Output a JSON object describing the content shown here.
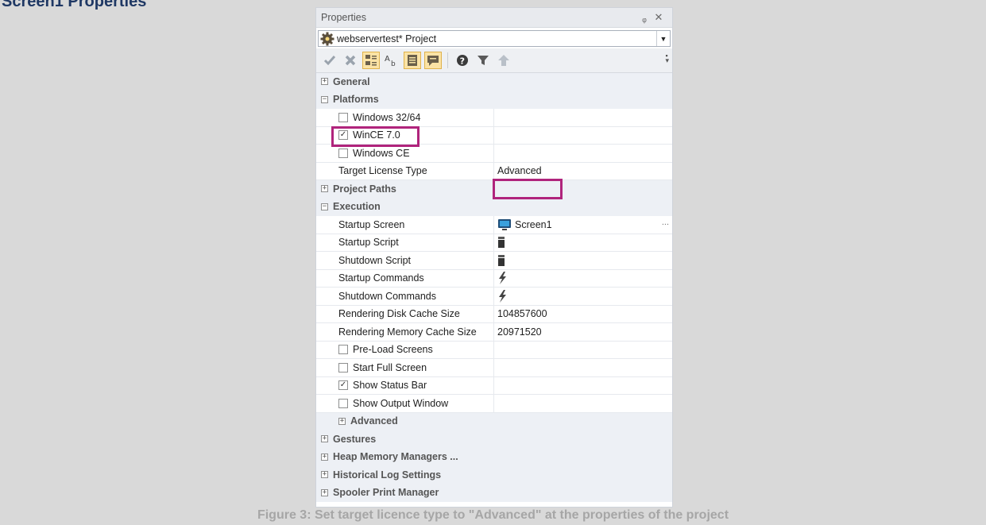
{
  "page": {
    "heading": "Screen1 Properties",
    "caption": "Figure 3: Set target licence type to \"Advanced\" at the properties of the project"
  },
  "panel": {
    "title": "Properties",
    "pin_icon": "pin-icon",
    "close_icon": "close-icon",
    "object_selector": {
      "value": "webservertest* Project"
    },
    "toolbar": {
      "buttons": [
        "apply-icon",
        "cancel-icon",
        "categorized-icon",
        "alphabetical-icon",
        "properties-icon",
        "events-icon",
        "help-icon",
        "filter-icon",
        "up-icon"
      ]
    }
  },
  "rows": {
    "general": "General",
    "platforms": "Platforms",
    "win3264": "Windows 32/64",
    "wince70": "WinCE 7.0",
    "wince": "Windows CE",
    "target_license_type": "Target License Type",
    "target_license_value": "Advanced",
    "project_paths": "Project Paths",
    "execution": "Execution",
    "startup_screen": "Startup Screen",
    "startup_screen_value": "Screen1",
    "startup_script": "Startup Script",
    "shutdown_script": "Shutdown Script",
    "startup_commands": "Startup Commands",
    "shutdown_commands": "Shutdown Commands",
    "disk_cache": "Rendering Disk Cache Size",
    "disk_cache_value": "104857600",
    "memory_cache": "Rendering Memory Cache Size",
    "memory_cache_value": "20971520",
    "preload": "Pre-Load Screens",
    "fullscreen": "Start Full Screen",
    "statusbar": "Show Status Bar",
    "outputwindow": "Show Output Window",
    "advanced": "Advanced",
    "gestures": "Gestures",
    "heap": "Heap Memory Managers ...",
    "histlog": "Historical Log Settings",
    "spooler": "Spooler Print Manager",
    "ellipsis": "..."
  },
  "checks": {
    "win3264": false,
    "wince70": true,
    "wince": false,
    "preload": false,
    "fullscreen": false,
    "statusbar": true,
    "outputwindow": false
  },
  "colors": {
    "highlight": "#b0247c",
    "category_bg": "#edf0f5",
    "toolbar_active": "#fbe3a5"
  }
}
